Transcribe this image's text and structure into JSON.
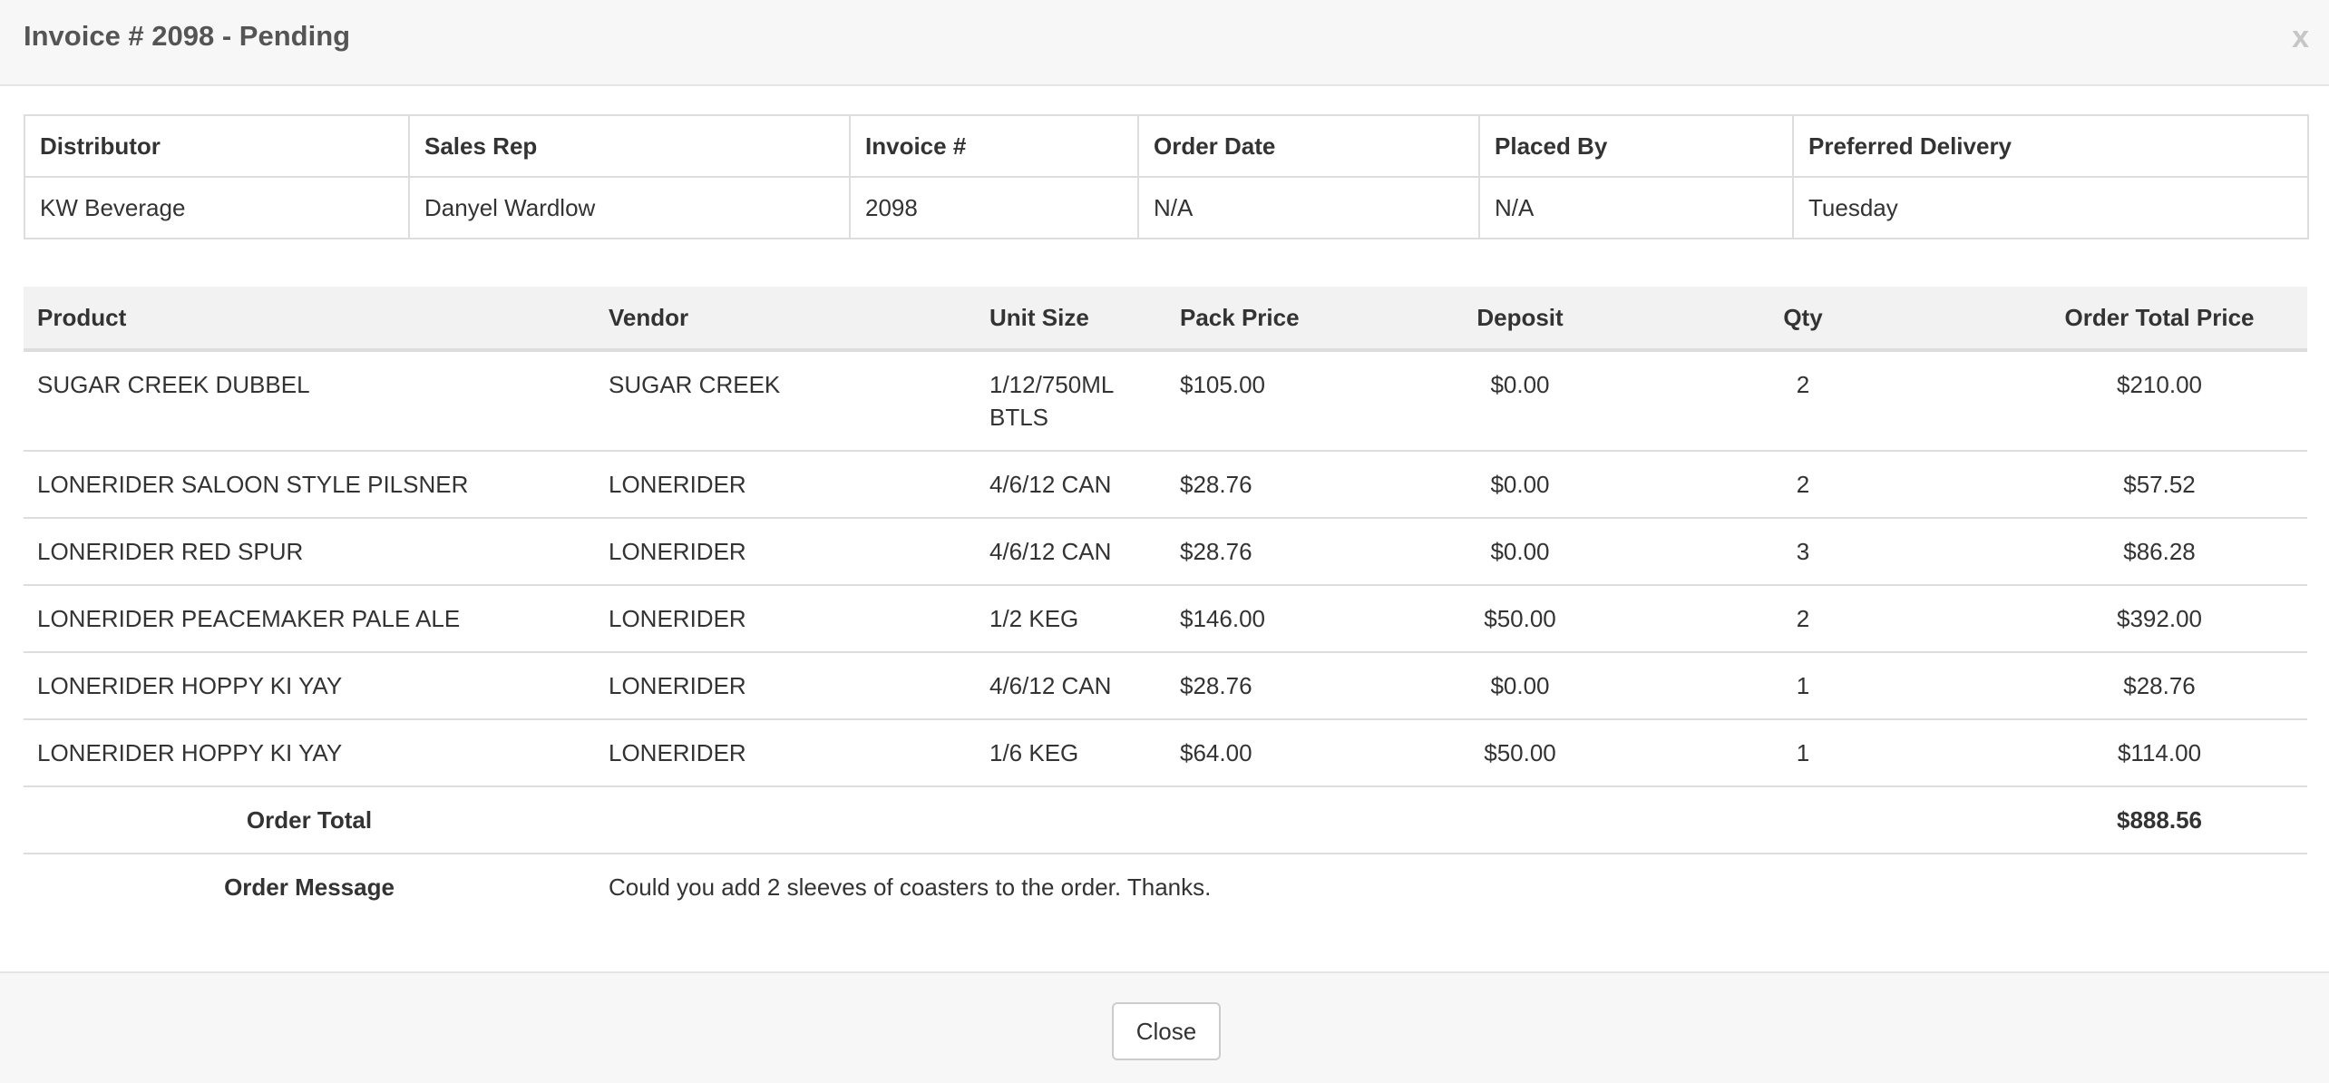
{
  "header": {
    "title": "Invoice # 2098 - Pending",
    "close_symbol": "x"
  },
  "info": {
    "headers": [
      "Distributor",
      "Sales Rep",
      "Invoice #",
      "Order Date",
      "Placed By",
      "Preferred Delivery"
    ],
    "values": [
      "KW Beverage",
      "Danyel Wardlow",
      "2098",
      "N/A",
      "N/A",
      "Tuesday"
    ]
  },
  "products": {
    "headers": [
      "Product",
      "Vendor",
      "Unit Size",
      "Pack Price",
      "Deposit",
      "Qty",
      "Order Total Price"
    ],
    "rows": [
      {
        "product": "SUGAR CREEK DUBBEL",
        "vendor": "SUGAR CREEK",
        "unit_size": "1/12/750ML BTLS",
        "pack_price": "$105.00",
        "deposit": "$0.00",
        "qty": "2",
        "total": "$210.00"
      },
      {
        "product": "LONERIDER SALOON STYLE PILSNER",
        "vendor": "LONERIDER",
        "unit_size": "4/6/12 CAN",
        "pack_price": "$28.76",
        "deposit": "$0.00",
        "qty": "2",
        "total": "$57.52"
      },
      {
        "product": "LONERIDER RED SPUR",
        "vendor": "LONERIDER",
        "unit_size": "4/6/12 CAN",
        "pack_price": "$28.76",
        "deposit": "$0.00",
        "qty": "3",
        "total": "$86.28"
      },
      {
        "product": "LONERIDER PEACEMAKER PALE ALE",
        "vendor": "LONERIDER",
        "unit_size": "1/2 KEG",
        "pack_price": "$146.00",
        "deposit": "$50.00",
        "qty": "2",
        "total": "$392.00"
      },
      {
        "product": "LONERIDER HOPPY KI YAY",
        "vendor": "LONERIDER",
        "unit_size": "4/6/12 CAN",
        "pack_price": "$28.76",
        "deposit": "$0.00",
        "qty": "1",
        "total": "$28.76"
      },
      {
        "product": "LONERIDER HOPPY KI YAY",
        "vendor": "LONERIDER",
        "unit_size": "1/6 KEG",
        "pack_price": "$64.00",
        "deposit": "$50.00",
        "qty": "1",
        "total": "$114.00"
      }
    ],
    "order_total_label": "Order Total",
    "order_total_value": "$888.56",
    "order_message_label": "Order Message",
    "order_message": "Could you add 2 sleeves of coasters to the order. Thanks."
  },
  "footer": {
    "close_label": "Close"
  }
}
